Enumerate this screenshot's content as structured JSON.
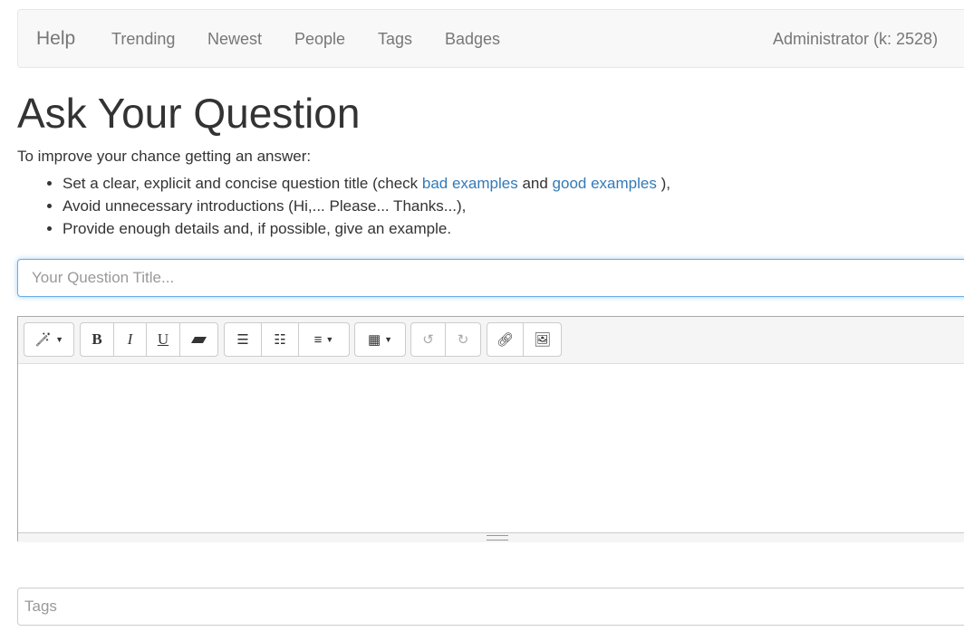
{
  "nav": {
    "brand": "Help",
    "links": [
      "Trending",
      "Newest",
      "People",
      "Tags",
      "Badges"
    ],
    "user": "Administrator (k: 2528)"
  },
  "page_title": "Ask Your Question",
  "intro": "To improve your chance getting an answer:",
  "tips": {
    "t1_pre": "Set a clear, explicit and concise question title (check ",
    "t1_bad": "bad examples",
    "t1_mid": " and ",
    "t1_good": "good examples",
    "t1_post": " ),",
    "t2": "Avoid unnecessary introductions (Hi,... Please... Thanks...),",
    "t3": "Provide enough details and, if possible, give an example."
  },
  "title_input": {
    "placeholder": "Your Question Title...",
    "value": ""
  },
  "toolbar": {
    "bold": "B",
    "italic": "I",
    "underline": "U"
  },
  "tags_input": {
    "placeholder": "Tags",
    "value": ""
  }
}
